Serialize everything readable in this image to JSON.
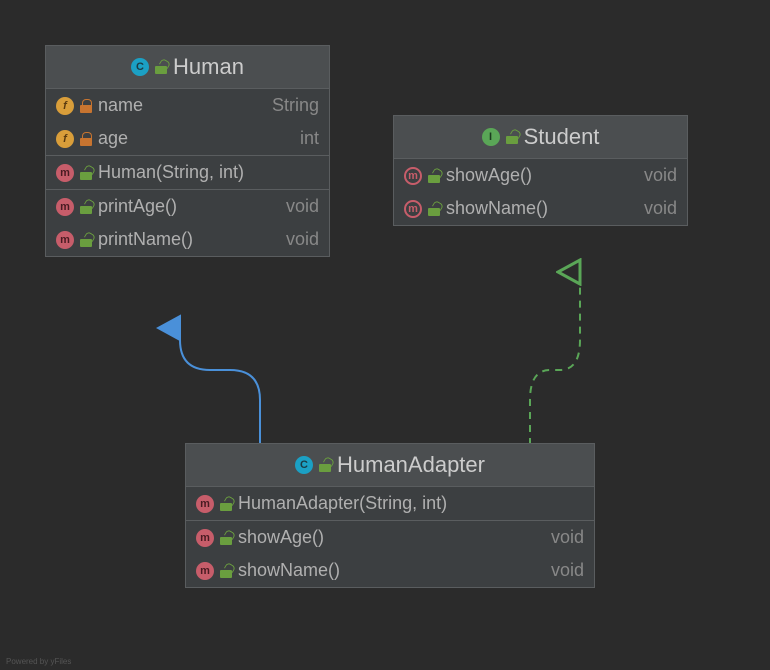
{
  "classes": {
    "human": {
      "stereotype": "class",
      "name": "Human",
      "fields": [
        {
          "name": "name",
          "type": "String",
          "vis": "private"
        },
        {
          "name": "age",
          "type": "int",
          "vis": "private"
        }
      ],
      "constructors": [
        {
          "sig": "Human(String, int)",
          "vis": "public"
        }
      ],
      "methods": [
        {
          "sig": "printAge()",
          "ret": "void",
          "vis": "public"
        },
        {
          "sig": "printName()",
          "ret": "void",
          "vis": "public"
        }
      ]
    },
    "student": {
      "stereotype": "interface",
      "name": "Student",
      "methods": [
        {
          "sig": "showAge()",
          "ret": "void",
          "vis": "public",
          "abstract": true
        },
        {
          "sig": "showName()",
          "ret": "void",
          "vis": "public",
          "abstract": true
        }
      ]
    },
    "adapter": {
      "stereotype": "class",
      "name": "HumanAdapter",
      "constructors": [
        {
          "sig": "HumanAdapter(String, int)",
          "vis": "public"
        }
      ],
      "methods": [
        {
          "sig": "showAge()",
          "ret": "void",
          "vis": "public"
        },
        {
          "sig": "showName()",
          "ret": "void",
          "vis": "public"
        }
      ]
    }
  },
  "relations": [
    {
      "from": "adapter",
      "to": "human",
      "kind": "extends"
    },
    {
      "from": "adapter",
      "to": "student",
      "kind": "implements"
    }
  ],
  "footer": "Powered by yFiles",
  "colors": {
    "extends": "#4a90d9",
    "implements": "#5aa657"
  }
}
